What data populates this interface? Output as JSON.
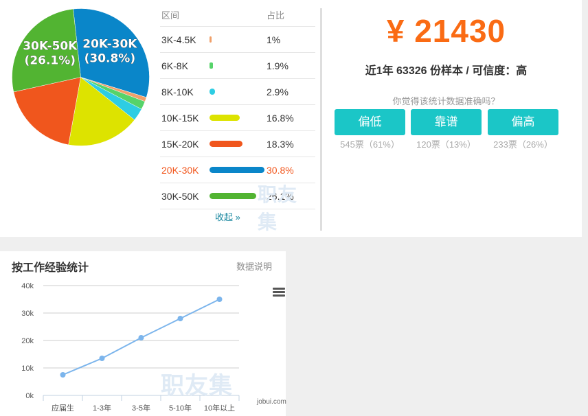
{
  "salary_summary": {
    "amount": "¥ 21430",
    "subtitle": "近1年 63326 份样本 / 可信度：高",
    "question": "你觉得该统计数据准确吗？",
    "votes": [
      {
        "label": "偏低",
        "count": "545票（61%）"
      },
      {
        "label": "靠谱",
        "count": "120票（13%）"
      },
      {
        "label": "偏高",
        "count": "233票（26%）"
      }
    ]
  },
  "distribution_table": {
    "header_range": "区间",
    "header_pct": "占比",
    "collapse_label": "收起 »",
    "watermark": "职友集",
    "highlight_color": "#f2571d"
  },
  "line_panel": {
    "title": "按工作经验统计",
    "note": "数据说明",
    "watermark": "职友集",
    "credit": "jobui.com",
    "menu_icon": "hamburger-menu-icon"
  },
  "chart_data": [
    {
      "type": "pie",
      "categories": [
        "3K-4.5K",
        "6K-8K",
        "8K-10K",
        "10K-15K",
        "15K-20K",
        "20K-30K",
        "30K-50K"
      ],
      "values": [
        1,
        1.9,
        2.9,
        16.8,
        18.3,
        30.8,
        26.1
      ],
      "display": [
        "1%",
        "1.9%",
        "2.9%",
        "16.8%",
        "18.3%",
        "30.8%",
        "26.1%"
      ],
      "colors": [
        "#f0a06a",
        "#56d36a",
        "#2ecde3",
        "#dde300",
        "#f0561d",
        "#0a86c9",
        "#52b432"
      ],
      "highlight_index": 5,
      "slice_labels": [
        {
          "index": 5,
          "lines": [
            "20K-30K",
            "(30.8%)"
          ]
        },
        {
          "index": 6,
          "lines": [
            "30K-50K",
            "(26.1%)"
          ]
        }
      ]
    },
    {
      "type": "line",
      "categories": [
        "应届生",
        "1-3年",
        "3-5年",
        "5-10年",
        "10年以上"
      ],
      "values": [
        7500,
        13500,
        21000,
        28000,
        35000
      ],
      "ylim": [
        0,
        40000
      ],
      "yticks": [
        0,
        10000,
        20000,
        30000,
        40000
      ],
      "ytick_labels": [
        "0k",
        "10k",
        "20k",
        "30k",
        "40k"
      ],
      "grid": true,
      "color": "#7cb5ec"
    }
  ]
}
